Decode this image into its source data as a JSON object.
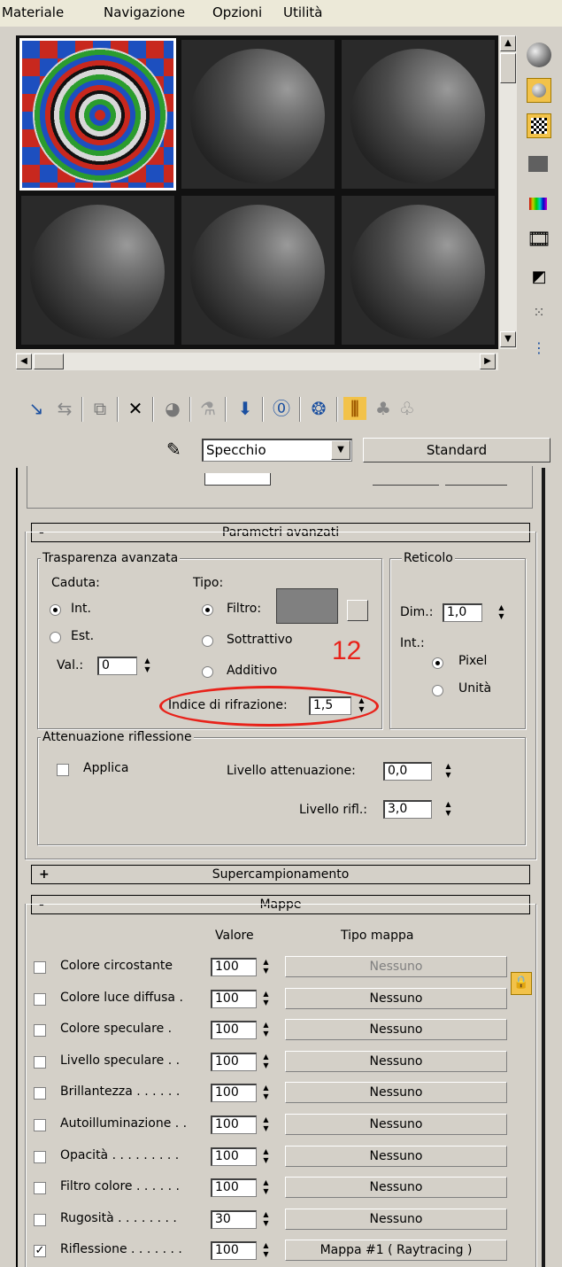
{
  "menu": [
    "Materiale",
    "Navigazione",
    "Opzioni",
    "Utilità"
  ],
  "toolbar": {
    "icons": [
      "get-material-icon",
      "put-to-scene-icon",
      "assign-material-icon",
      "reset-icon",
      "copy-material-icon",
      "unique-icon",
      "put-library-icon",
      "material-effects-icon",
      "show-map-icon",
      "show-end-result-icon",
      "go-to-parent-icon",
      "go-forward-icon"
    ]
  },
  "material": {
    "name": "Specchio",
    "type": "Standard"
  },
  "advanced": {
    "title": "Parametri avanzati",
    "sign": "-",
    "transparency_group": "Trasparenza avanzata",
    "falloff_label": "Caduta:",
    "falloff_in": "Int.",
    "falloff_out": "Est.",
    "amount_label": "Val.:",
    "amount_value": "0",
    "type_label": "Tipo:",
    "type_filter": "Filtro:",
    "type_subtractive": "Sottrattivo",
    "type_additive": "Additivo",
    "ior_label": "Indice di rifrazione:",
    "ior_value": "1,5",
    "annotation": "12",
    "annotation_color": "#e8221a",
    "filter_color": "#808080",
    "wire_group": "Reticolo",
    "wire_size_label": "Dim.:",
    "wire_size_value": "1,0",
    "wire_in_label": "Int.:",
    "wire_pixel": "Pixel",
    "wire_units": "Unità",
    "refl_group": "Attenuazione riflessione",
    "apply_label": "Applica",
    "dim_level_label": "Livello attenuazione:",
    "dim_level_value": "0,0",
    "refl_level_label": "Livello rifl.:",
    "refl_level_value": "3,0"
  },
  "supersampling": {
    "title": "Supercampionamento",
    "sign": "+"
  },
  "maps": {
    "title": "Mappe",
    "sign": "-",
    "col_amount": "Valore",
    "col_type": "Tipo mappa",
    "rows": [
      {
        "label": "Colore circostante",
        "value": "100",
        "map": "Nessuno",
        "checked": false,
        "disabled": true
      },
      {
        "label": "Colore luce diffusa .",
        "value": "100",
        "map": "Nessuno",
        "checked": false,
        "disabled": false
      },
      {
        "label": "Colore speculare  .",
        "value": "100",
        "map": "Nessuno",
        "checked": false,
        "disabled": false
      },
      {
        "label": "Livello speculare . .",
        "value": "100",
        "map": "Nessuno",
        "checked": false,
        "disabled": false
      },
      {
        "label": "Brillantezza  . . . . . .",
        "value": "100",
        "map": "Nessuno",
        "checked": false,
        "disabled": false
      },
      {
        "label": "Autoilluminazione . .",
        "value": "100",
        "map": "Nessuno",
        "checked": false,
        "disabled": false
      },
      {
        "label": "Opacità . . . . . . . . .",
        "value": "100",
        "map": "Nessuno",
        "checked": false,
        "disabled": false
      },
      {
        "label": "Filtro colore . . . . . .",
        "value": "100",
        "map": "Nessuno",
        "checked": false,
        "disabled": false
      },
      {
        "label": "Rugosità  . . . . . . . .",
        "value": "30",
        "map": "Nessuno",
        "checked": false,
        "disabled": false
      },
      {
        "label": "Riflessione . . . . . . .",
        "value": "100",
        "map": "Mappa #1  ( Raytracing )",
        "checked": true,
        "disabled": false
      }
    ]
  }
}
